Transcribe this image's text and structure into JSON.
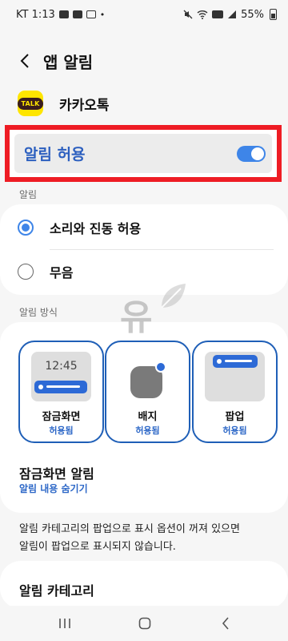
{
  "status": {
    "carrier_time": "KT 1:13",
    "battery": "55%",
    "dot": "•",
    "left_icons": [
      "image-icon",
      "youtube-icon",
      "instagram-icon"
    ],
    "right_icons": [
      "mute-icon",
      "wifi-icon",
      "volte-icon",
      "signal-icon",
      "battery-icon"
    ]
  },
  "header": {
    "title": "앱 알림"
  },
  "app": {
    "name": "카카오톡",
    "icon_text": "TALK"
  },
  "allow": {
    "label": "알림 허용",
    "enabled": true
  },
  "notifications": {
    "section_label": "알림",
    "options": [
      {
        "label": "소리와 진동 허용",
        "selected": true
      },
      {
        "label": "무음",
        "selected": false
      }
    ]
  },
  "styles": {
    "section_label": "알림 방식",
    "tiles": [
      {
        "name": "잠금화면",
        "status": "허용됨",
        "preview_time": "12:45"
      },
      {
        "name": "배지",
        "status": "허용됨"
      },
      {
        "name": "팝업",
        "status": "허용됨"
      }
    ]
  },
  "lockscreen_alert": {
    "title": "잠금화면 알림",
    "subtitle": "알림 내용 숨기기"
  },
  "info": {
    "line1": "알림 카테고리의 팝업으로 표시 옵션이 꺼져 있으면",
    "line2": "알림이 팝업으로 표시되지 않습니다."
  },
  "category": {
    "title": "알림 카테고리"
  },
  "watermark": {
    "text": "유"
  },
  "colors": {
    "accent": "#3e85e8",
    "highlight": "#ee1c24",
    "link": "#2c67c7"
  }
}
